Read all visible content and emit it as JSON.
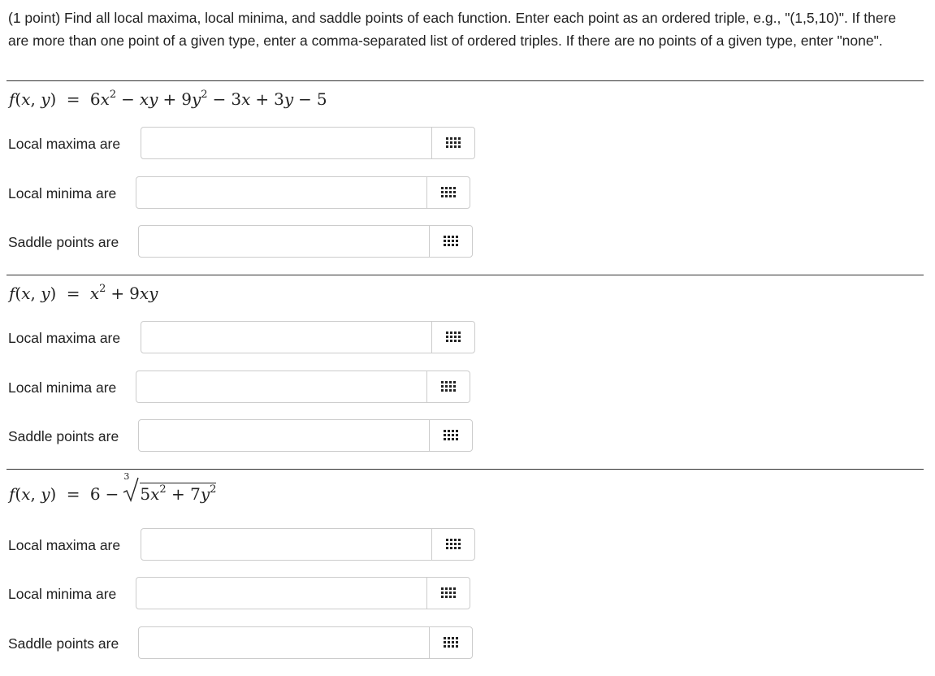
{
  "intro": "(1 point) Find all local maxima, local minima, and saddle points of each function. Enter each point as an ordered triple, e.g., \"(1,5,10)\". If there are more than one point of a given type, enter a comma-separated list of ordered triples. If there are no points of a given type, enter \"none\".",
  "labels": {
    "max": "Local maxima are",
    "min": "Local minima are",
    "saddle": "Saddle points are"
  },
  "problems": [
    {
      "formula": "f(x, y) = 6x² − xy + 9y² − 3x + 3y − 5",
      "answers": {
        "max": "",
        "min": "",
        "saddle": ""
      }
    },
    {
      "formula": "f(x, y) = x² + 9xy",
      "answers": {
        "max": "",
        "min": "",
        "saddle": ""
      }
    },
    {
      "formula": "f(x, y) = 6 − ∛(5x² + 7y²)",
      "answers": {
        "max": "",
        "min": "",
        "saddle": ""
      }
    }
  ],
  "icon": "equation-editor-grid-icon"
}
